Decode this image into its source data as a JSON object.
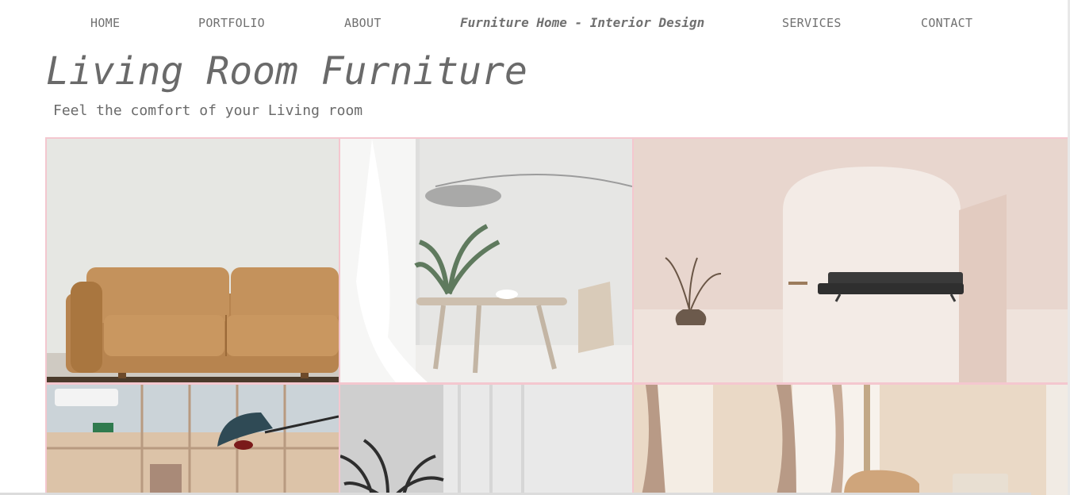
{
  "nav": {
    "items": [
      {
        "label": "HOME"
      },
      {
        "label": "PORTFOLIO"
      },
      {
        "label": "ABOUT"
      },
      {
        "label": "SERVICES"
      },
      {
        "label": "CONTACT"
      }
    ],
    "brand": "Furniture Home - Interior Design"
  },
  "hero": {
    "title": "Living Room Furniture",
    "subtitle": "Feel the comfort of your Living room"
  },
  "gallery": {
    "border_color": "#f4c7cf",
    "photos": [
      {
        "subject": "leather-sofa"
      },
      {
        "subject": "white-table-plant"
      },
      {
        "subject": "pink-arch-room"
      },
      {
        "subject": "lamp-windows"
      },
      {
        "subject": "white-curtain-plant"
      },
      {
        "subject": "beige-room-chair"
      }
    ]
  }
}
